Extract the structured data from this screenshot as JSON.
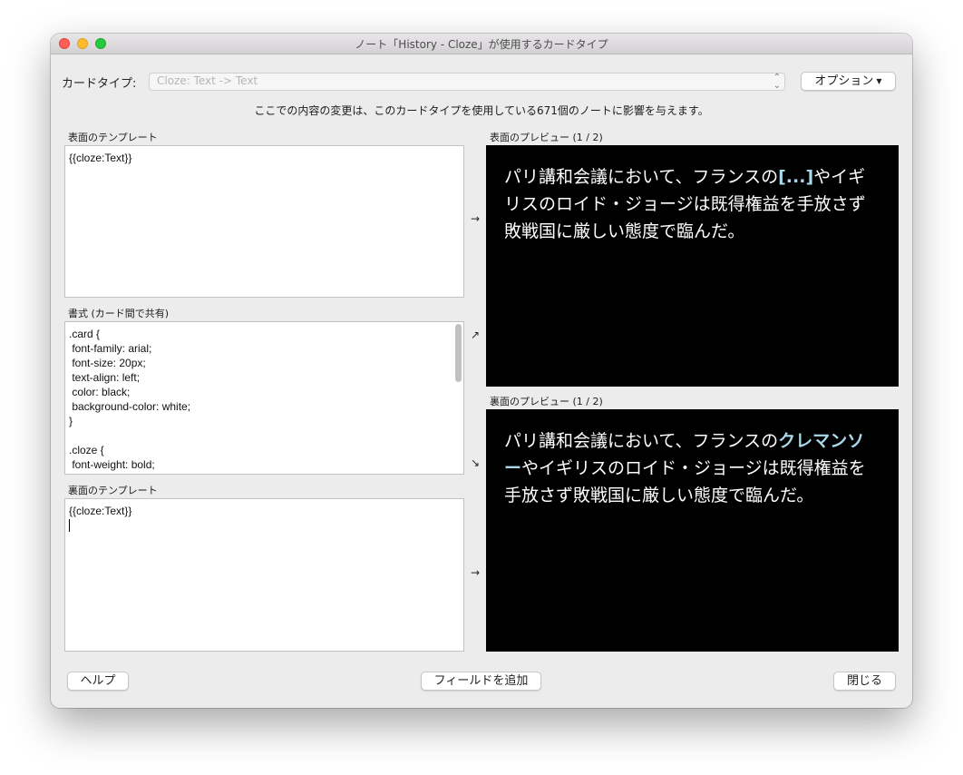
{
  "window": {
    "title": "ノート「History - Cloze」が使用するカードタイプ"
  },
  "card_type": {
    "label": "カードタイプ:",
    "value": "Cloze: Text -> Text",
    "options_button": "オプション"
  },
  "notice": "ここでの内容の変更は、このカードタイプを使用している671個のノートに影響を与えます。",
  "front_template": {
    "label": "表面のテンプレート",
    "content": "{{cloze:Text}}"
  },
  "styling": {
    "label": "書式 (カード間で共有)",
    "content": ".card {\n font-family: arial;\n font-size: 20px;\n text-align: left;\n color: black;\n background-color: white;\n}\n\n.cloze {\n font-weight: bold;\n color: blue;"
  },
  "back_template": {
    "label": "裏面のテンプレート",
    "content": "{{cloze:Text}}\n"
  },
  "front_preview": {
    "label": "表面のプレビュー (1 / 2)",
    "before": "パリ講和会議において、フランスの",
    "cloze": "[...]",
    "after": "やイギリスのロイド・ジョージは既得権益を手放さず敗戦国に厳しい態度で臨んだ。"
  },
  "back_preview": {
    "label": "裏面のプレビュー (1 / 2)",
    "before": "パリ講和会議において、フランスの",
    "cloze": "クレマンソー",
    "after": "やイギリスのロイド・ジョージは既得権益を手放さず敗戦国に厳しい態度で臨んだ。"
  },
  "arrows": {
    "front": "→",
    "styling": "↗",
    "styling_back": "↘",
    "back": "→"
  },
  "footer": {
    "help": "ヘルプ",
    "add_field": "フィールドを追加",
    "close": "閉じる"
  },
  "colors": {
    "cloze_highlight": "#a8d8ea",
    "preview_background": "#000000"
  }
}
